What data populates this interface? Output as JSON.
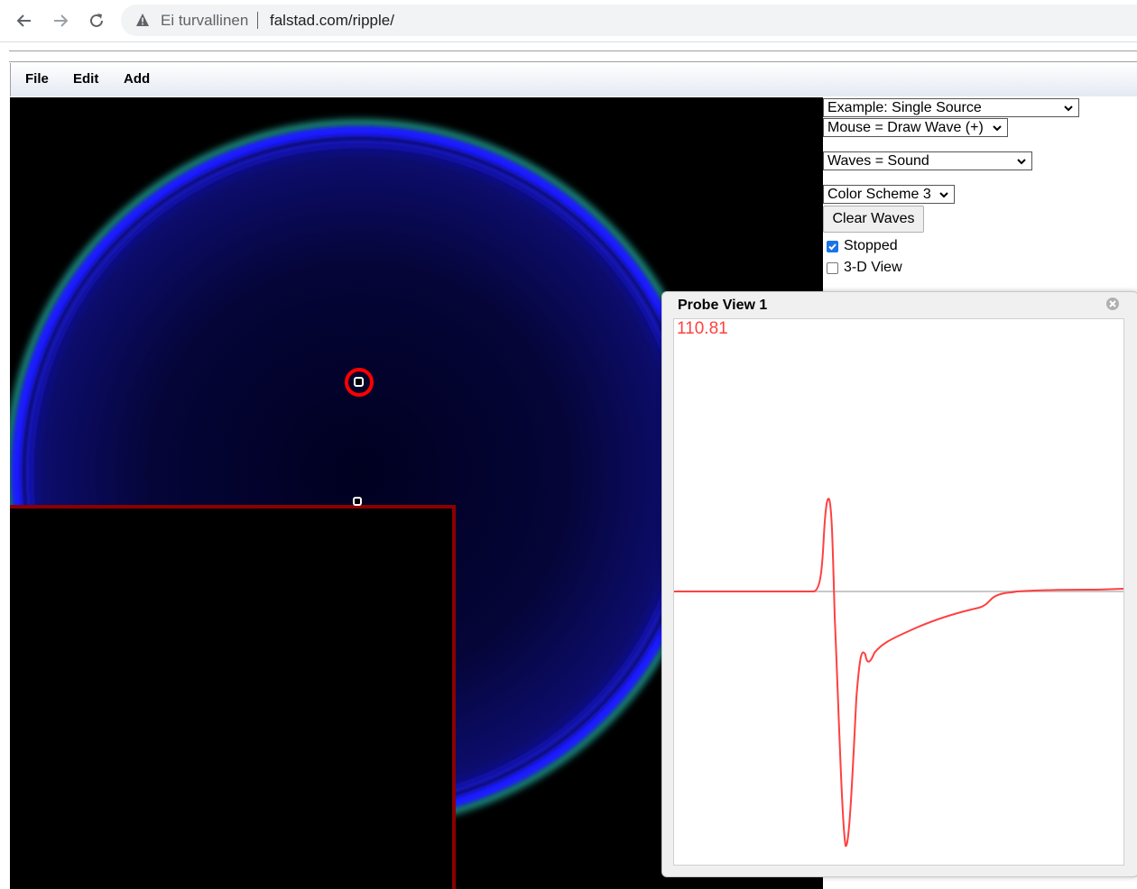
{
  "browser": {
    "security_label": "Ei turvallinen",
    "url": "falstad.com/ripple/",
    "icons": [
      "back-arrow-icon",
      "forward-arrow-icon",
      "reload-icon",
      "warning-icon"
    ]
  },
  "menu": {
    "file": "File",
    "edit": "Edit",
    "add": "Add"
  },
  "controls": {
    "example_select": "Example: Single Source",
    "mouse_select": "Mouse = Draw Wave (+)",
    "waves_select": "Waves = Sound",
    "color_select": "Color Scheme 3",
    "clear_button": "Clear Waves",
    "stopped_label": "Stopped",
    "stopped_checked": true,
    "view3d_label": "3-D View",
    "view3d_checked": false
  },
  "probe": {
    "title": "Probe View 1",
    "value": "110.81",
    "trace_color": "#ff4040"
  },
  "colors": {
    "wave_blue": "#1a1aff",
    "wave_teal": "#1a8a80",
    "wall_red": "#8b0000",
    "source_marker": "#ff0000"
  }
}
